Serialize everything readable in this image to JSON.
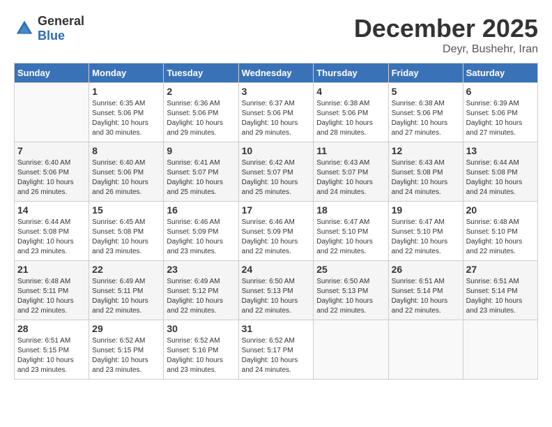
{
  "header": {
    "logo_general": "General",
    "logo_blue": "Blue",
    "month_title": "December 2025",
    "location": "Deyr, Bushehr, Iran"
  },
  "days_of_week": [
    "Sunday",
    "Monday",
    "Tuesday",
    "Wednesday",
    "Thursday",
    "Friday",
    "Saturday"
  ],
  "weeks": [
    [
      {
        "day": "",
        "sunrise": "",
        "sunset": "",
        "daylight": ""
      },
      {
        "day": "1",
        "sunrise": "Sunrise: 6:35 AM",
        "sunset": "Sunset: 5:06 PM",
        "daylight": "Daylight: 10 hours and 30 minutes."
      },
      {
        "day": "2",
        "sunrise": "Sunrise: 6:36 AM",
        "sunset": "Sunset: 5:06 PM",
        "daylight": "Daylight: 10 hours and 29 minutes."
      },
      {
        "day": "3",
        "sunrise": "Sunrise: 6:37 AM",
        "sunset": "Sunset: 5:06 PM",
        "daylight": "Daylight: 10 hours and 29 minutes."
      },
      {
        "day": "4",
        "sunrise": "Sunrise: 6:38 AM",
        "sunset": "Sunset: 5:06 PM",
        "daylight": "Daylight: 10 hours and 28 minutes."
      },
      {
        "day": "5",
        "sunrise": "Sunrise: 6:38 AM",
        "sunset": "Sunset: 5:06 PM",
        "daylight": "Daylight: 10 hours and 27 minutes."
      },
      {
        "day": "6",
        "sunrise": "Sunrise: 6:39 AM",
        "sunset": "Sunset: 5:06 PM",
        "daylight": "Daylight: 10 hours and 27 minutes."
      }
    ],
    [
      {
        "day": "7",
        "sunrise": "Sunrise: 6:40 AM",
        "sunset": "Sunset: 5:06 PM",
        "daylight": "Daylight: 10 hours and 26 minutes."
      },
      {
        "day": "8",
        "sunrise": "Sunrise: 6:40 AM",
        "sunset": "Sunset: 5:06 PM",
        "daylight": "Daylight: 10 hours and 26 minutes."
      },
      {
        "day": "9",
        "sunrise": "Sunrise: 6:41 AM",
        "sunset": "Sunset: 5:07 PM",
        "daylight": "Daylight: 10 hours and 25 minutes."
      },
      {
        "day": "10",
        "sunrise": "Sunrise: 6:42 AM",
        "sunset": "Sunset: 5:07 PM",
        "daylight": "Daylight: 10 hours and 25 minutes."
      },
      {
        "day": "11",
        "sunrise": "Sunrise: 6:43 AM",
        "sunset": "Sunset: 5:07 PM",
        "daylight": "Daylight: 10 hours and 24 minutes."
      },
      {
        "day": "12",
        "sunrise": "Sunrise: 6:43 AM",
        "sunset": "Sunset: 5:08 PM",
        "daylight": "Daylight: 10 hours and 24 minutes."
      },
      {
        "day": "13",
        "sunrise": "Sunrise: 6:44 AM",
        "sunset": "Sunset: 5:08 PM",
        "daylight": "Daylight: 10 hours and 24 minutes."
      }
    ],
    [
      {
        "day": "14",
        "sunrise": "Sunrise: 6:44 AM",
        "sunset": "Sunset: 5:08 PM",
        "daylight": "Daylight: 10 hours and 23 minutes."
      },
      {
        "day": "15",
        "sunrise": "Sunrise: 6:45 AM",
        "sunset": "Sunset: 5:08 PM",
        "daylight": "Daylight: 10 hours and 23 minutes."
      },
      {
        "day": "16",
        "sunrise": "Sunrise: 6:46 AM",
        "sunset": "Sunset: 5:09 PM",
        "daylight": "Daylight: 10 hours and 23 minutes."
      },
      {
        "day": "17",
        "sunrise": "Sunrise: 6:46 AM",
        "sunset": "Sunset: 5:09 PM",
        "daylight": "Daylight: 10 hours and 22 minutes."
      },
      {
        "day": "18",
        "sunrise": "Sunrise: 6:47 AM",
        "sunset": "Sunset: 5:10 PM",
        "daylight": "Daylight: 10 hours and 22 minutes."
      },
      {
        "day": "19",
        "sunrise": "Sunrise: 6:47 AM",
        "sunset": "Sunset: 5:10 PM",
        "daylight": "Daylight: 10 hours and 22 minutes."
      },
      {
        "day": "20",
        "sunrise": "Sunrise: 6:48 AM",
        "sunset": "Sunset: 5:10 PM",
        "daylight": "Daylight: 10 hours and 22 minutes."
      }
    ],
    [
      {
        "day": "21",
        "sunrise": "Sunrise: 6:48 AM",
        "sunset": "Sunset: 5:11 PM",
        "daylight": "Daylight: 10 hours and 22 minutes."
      },
      {
        "day": "22",
        "sunrise": "Sunrise: 6:49 AM",
        "sunset": "Sunset: 5:11 PM",
        "daylight": "Daylight: 10 hours and 22 minutes."
      },
      {
        "day": "23",
        "sunrise": "Sunrise: 6:49 AM",
        "sunset": "Sunset: 5:12 PM",
        "daylight": "Daylight: 10 hours and 22 minutes."
      },
      {
        "day": "24",
        "sunrise": "Sunrise: 6:50 AM",
        "sunset": "Sunset: 5:13 PM",
        "daylight": "Daylight: 10 hours and 22 minutes."
      },
      {
        "day": "25",
        "sunrise": "Sunrise: 6:50 AM",
        "sunset": "Sunset: 5:13 PM",
        "daylight": "Daylight: 10 hours and 22 minutes."
      },
      {
        "day": "26",
        "sunrise": "Sunrise: 6:51 AM",
        "sunset": "Sunset: 5:14 PM",
        "daylight": "Daylight: 10 hours and 22 minutes."
      },
      {
        "day": "27",
        "sunrise": "Sunrise: 6:51 AM",
        "sunset": "Sunset: 5:14 PM",
        "daylight": "Daylight: 10 hours and 23 minutes."
      }
    ],
    [
      {
        "day": "28",
        "sunrise": "Sunrise: 6:51 AM",
        "sunset": "Sunset: 5:15 PM",
        "daylight": "Daylight: 10 hours and 23 minutes."
      },
      {
        "day": "29",
        "sunrise": "Sunrise: 6:52 AM",
        "sunset": "Sunset: 5:15 PM",
        "daylight": "Daylight: 10 hours and 23 minutes."
      },
      {
        "day": "30",
        "sunrise": "Sunrise: 6:52 AM",
        "sunset": "Sunset: 5:16 PM",
        "daylight": "Daylight: 10 hours and 23 minutes."
      },
      {
        "day": "31",
        "sunrise": "Sunrise: 6:52 AM",
        "sunset": "Sunset: 5:17 PM",
        "daylight": "Daylight: 10 hours and 24 minutes."
      },
      {
        "day": "",
        "sunrise": "",
        "sunset": "",
        "daylight": ""
      },
      {
        "day": "",
        "sunrise": "",
        "sunset": "",
        "daylight": ""
      },
      {
        "day": "",
        "sunrise": "",
        "sunset": "",
        "daylight": ""
      }
    ]
  ]
}
